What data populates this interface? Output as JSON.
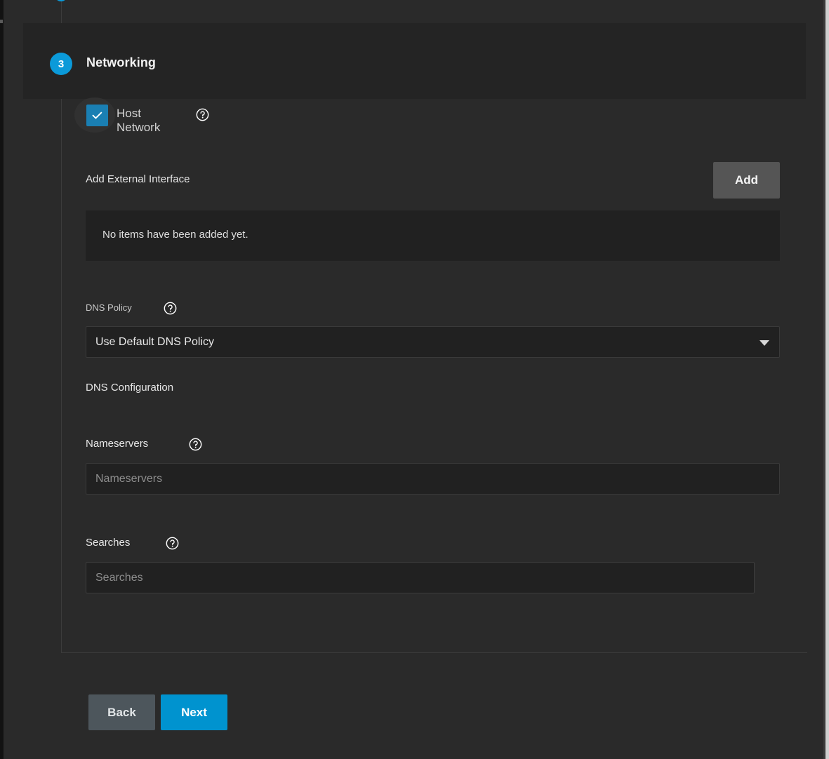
{
  "colors": {
    "accent": "#0b9ad9",
    "checkbox": "#1a7fb3",
    "next_button": "#0093cf",
    "back_button": "#4d565c",
    "add_button": "#555555",
    "panel_bg": "#212121",
    "page_bg": "#2a2a2a",
    "header_band_bg": "#242424",
    "divider": "#3c3c3c"
  },
  "step": {
    "number": "3",
    "title": "Networking"
  },
  "host_network": {
    "label": "Host Network",
    "checked": true,
    "help_icon": "help-circle-icon"
  },
  "external_interface": {
    "label": "Add External Interface",
    "add_button_label": "Add",
    "empty_message": "No items have been added yet."
  },
  "dns_policy": {
    "label": "DNS Policy",
    "help_icon": "help-circle-icon",
    "selected": "Use Default DNS Policy",
    "caret_icon": "chevron-down-icon"
  },
  "dns_configuration": {
    "section_label": "DNS Configuration",
    "nameservers": {
      "label": "Nameservers",
      "placeholder": "Nameservers",
      "value": "",
      "help_icon": "help-circle-icon"
    },
    "searches": {
      "label": "Searches",
      "placeholder": "Searches",
      "value": "",
      "help_icon": "help-circle-icon"
    }
  },
  "footer": {
    "back_label": "Back",
    "next_label": "Next"
  }
}
